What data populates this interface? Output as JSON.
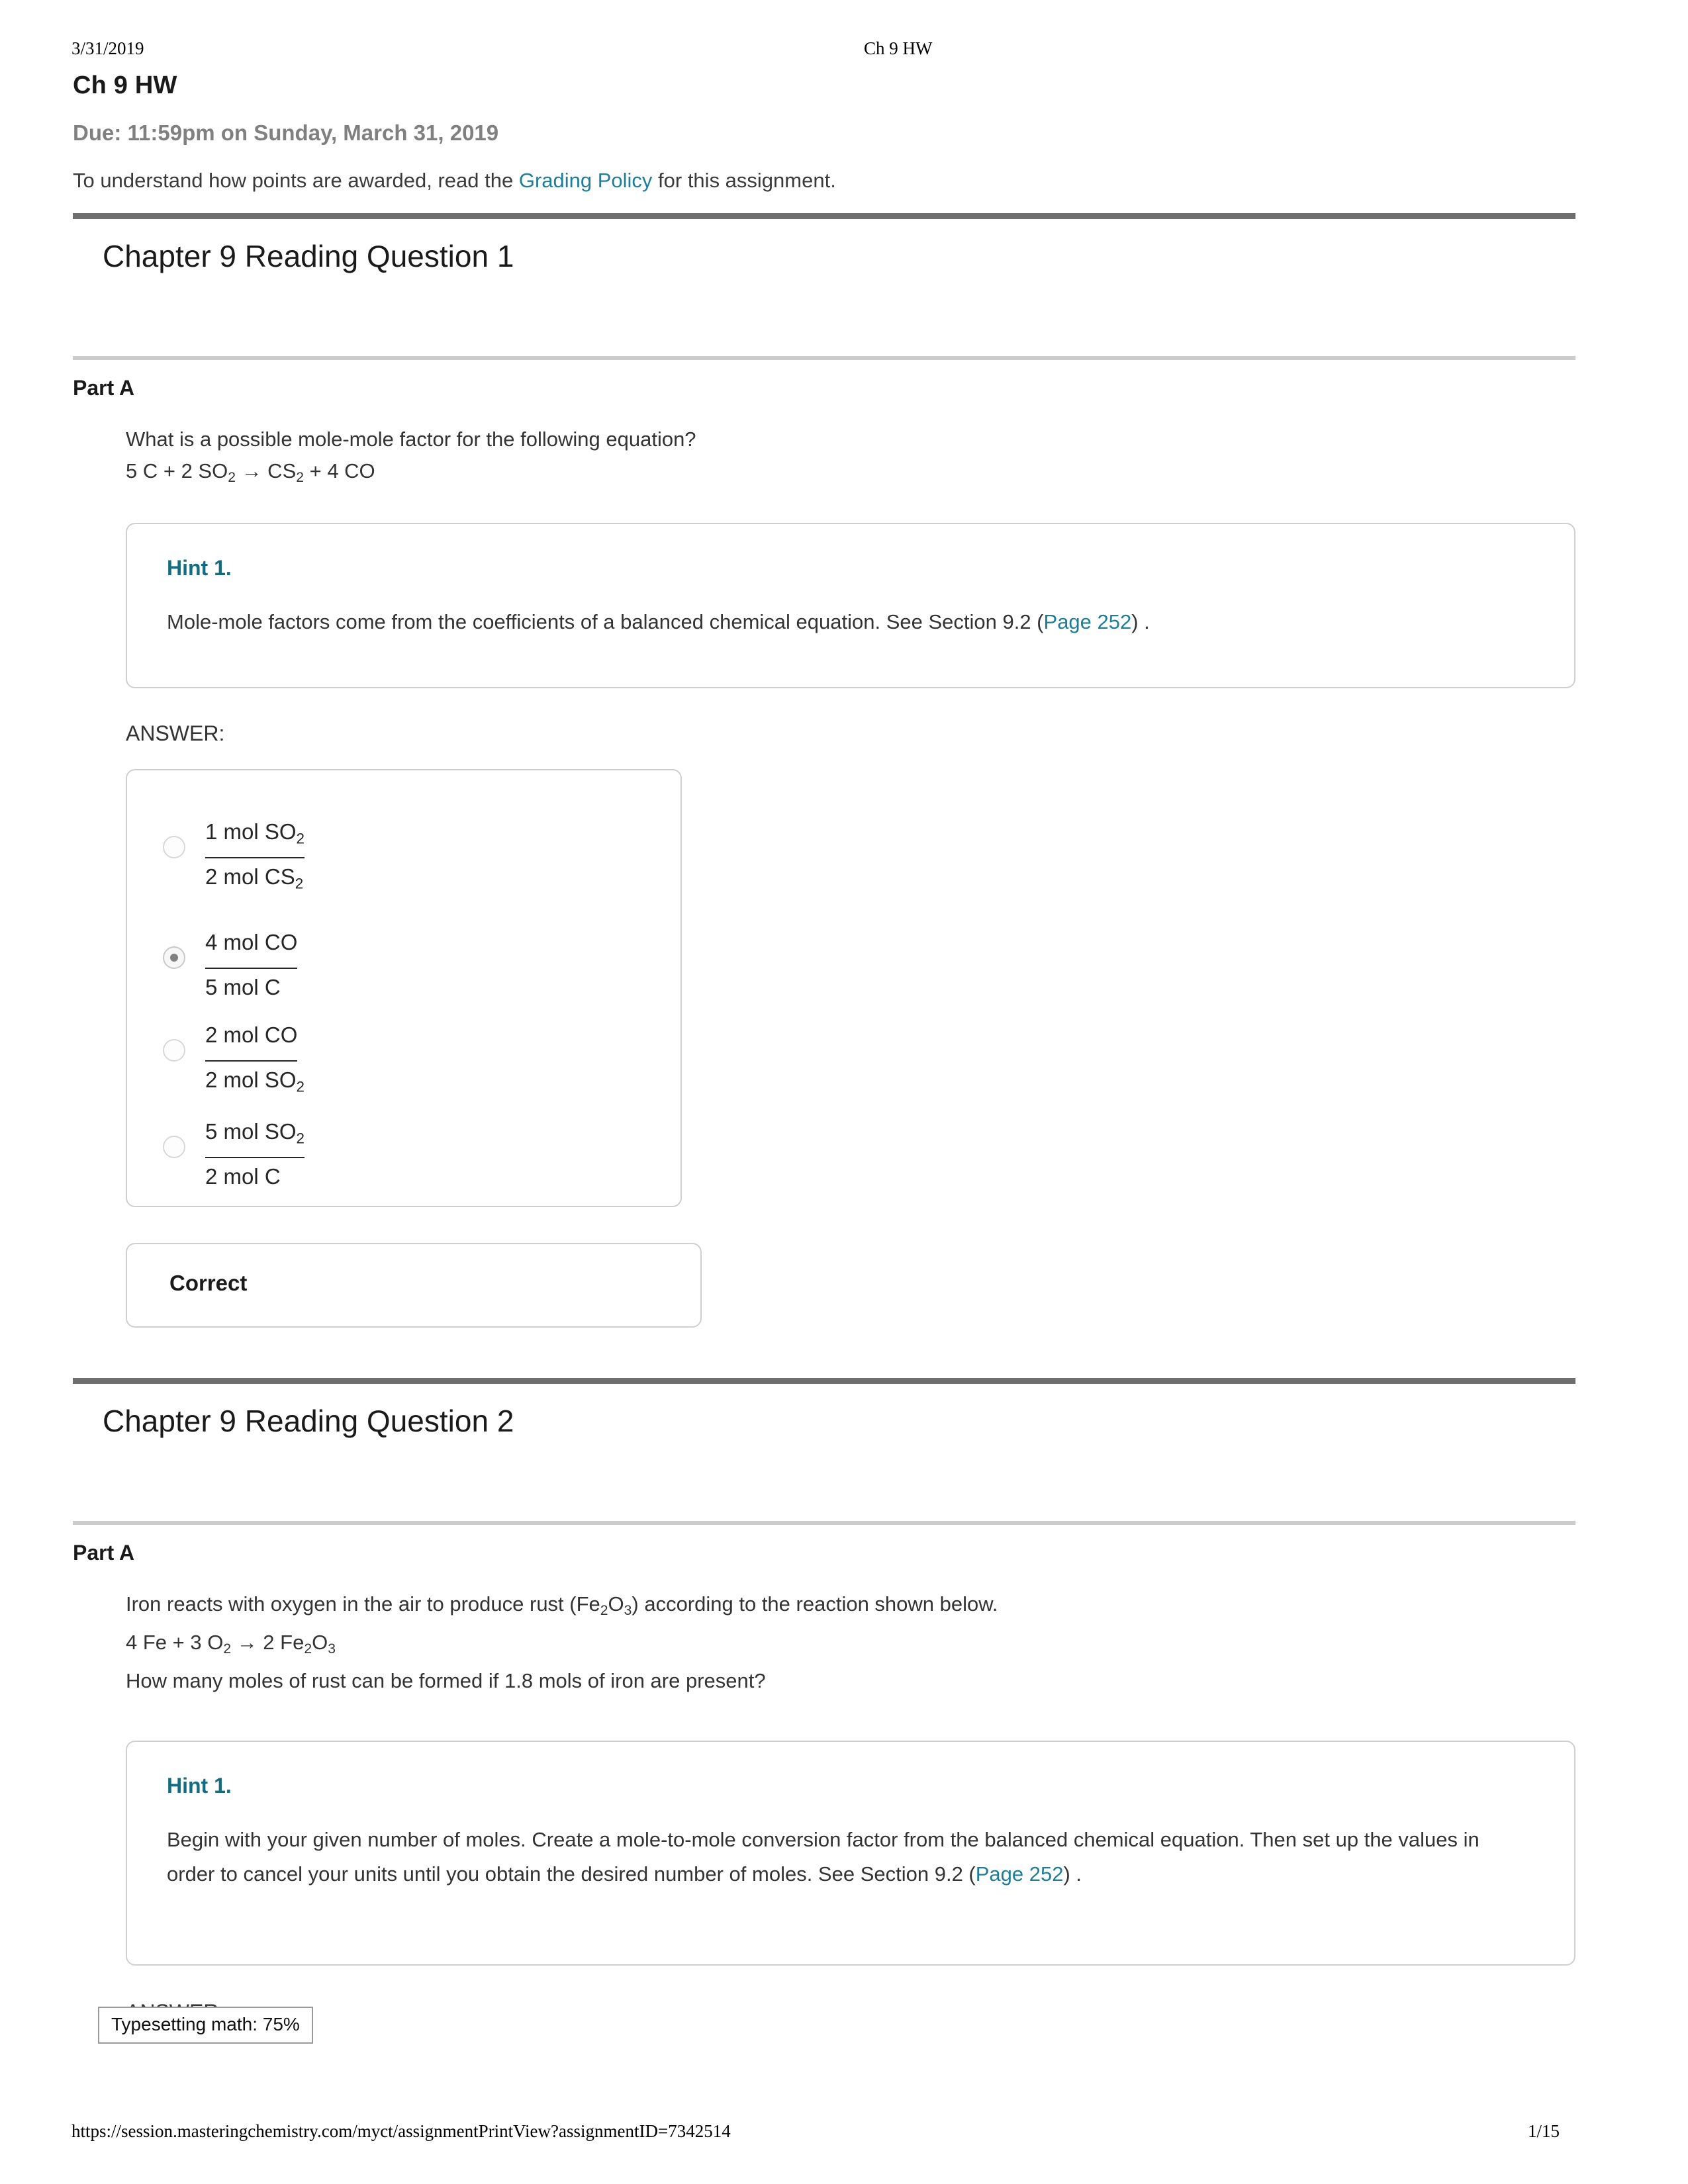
{
  "print_header": {
    "date": "3/31/2019",
    "document_title": "Ch 9 HW"
  },
  "assignment": {
    "title": "Ch 9 HW",
    "due": "Due: 11:59pm on Sunday, March 31, 2019",
    "note_before_link": "To understand how points are awarded, read the ",
    "grading_policy_link": "Grading Policy",
    "note_after_link": " for this assignment."
  },
  "problems": [
    {
      "title": "Chapter 9 Reading Question 1",
      "part_label": "Part A",
      "question_line1": "What is a possible mole-mole factor for the following equation?",
      "equation": {
        "c1": "5 C + 2 SO",
        "s1": "2",
        "arrow": " → CS",
        "s2": "2",
        "tail": " + 4 CO"
      },
      "hint": {
        "title": "Hint 1.",
        "text_before_link": "Mole-mole factors come from the coefficients of a balanced chemical equation. See Section 9.2 (",
        "link": "Page 252",
        "text_after_link": ") ."
      },
      "answer_label": "ANSWER:",
      "choices": [
        {
          "numerator": "1 mol SO",
          "num_sub": "2",
          "denominator": "2 mol CS",
          "den_sub": "2",
          "selected": false
        },
        {
          "numerator": "4 mol CO",
          "num_sub": "",
          "denominator": "5 mol C",
          "den_sub": "",
          "selected": true
        },
        {
          "numerator": "2 mol CO",
          "num_sub": "",
          "denominator": "2 mol SO",
          "den_sub": "2",
          "selected": false
        },
        {
          "numerator": "5 mol SO",
          "num_sub": "2",
          "denominator": "2 mol C",
          "den_sub": "",
          "selected": false
        }
      ],
      "feedback": "Correct"
    },
    {
      "title": "Chapter 9 Reading Question 2",
      "part_label": "Part A",
      "intro_a": "Iron reacts with oxygen in the air to produce rust (Fe",
      "intro_sub1": "2",
      "intro_b": "O",
      "intro_sub2": "3",
      "intro_c": ") according to the reaction shown below.",
      "equation": {
        "c1": "4 Fe + 3 O",
        "s1": "2",
        "arrow": " → 2 Fe",
        "s2": "2",
        "mid": "O",
        "s3": "3"
      },
      "question_line": "How many moles of rust can be formed if 1.8 mols of iron are present?",
      "hint": {
        "title": "Hint 1.",
        "text_before_link": "Begin with your given number of moles. Create a mole-to-mole conversion factor from the balanced chemical equation. Then set up the values in order to cancel your units until you obtain the desired number of moles. See Section 9.2 (",
        "link": "Page 252",
        "text_after_link": ") ."
      },
      "answer_label": "ANSWER:"
    }
  ],
  "mathjax_status": "Typesetting math: 75%",
  "footer": {
    "url": "https://session.masteringchemistry.com/myct/assignmentPrintView?assignmentID=7342514",
    "page": "1/15"
  },
  "colors": {
    "link": "#1e7e9a",
    "hint_title": "#156c80",
    "rule_dark": "#6e6e6e",
    "rule_light": "#cccccc"
  }
}
